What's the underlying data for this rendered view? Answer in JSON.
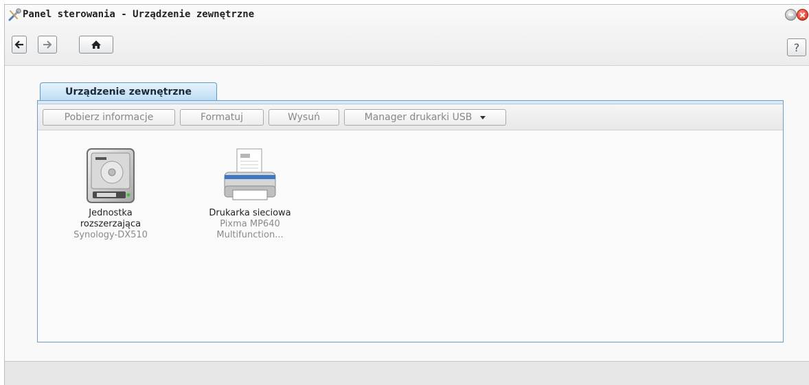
{
  "window": {
    "title": "Panel sterowania - Urządzenie zewnętrzne",
    "help_label": "?"
  },
  "tab": {
    "label": "Urządzenie zewnętrzne"
  },
  "toolbar": {
    "get_info": "Pobierz informacje",
    "format": "Formatuj",
    "eject": "Wysuń",
    "usb_printer_manager": "Manager drukarki USB"
  },
  "devices": [
    {
      "name_line1": "Jednostka",
      "name_line2": "rozszerzająca",
      "detail": "Synology-DX510",
      "icon": "hard-drive-icon"
    },
    {
      "name_line1": "Drukarka sieciowa",
      "detail_line1": "Pixma MP640",
      "detail_line2": "Multifunction...",
      "icon": "printer-icon"
    }
  ],
  "colors": {
    "tab_border": "#5e98c9",
    "close_red": "#d4210f"
  }
}
